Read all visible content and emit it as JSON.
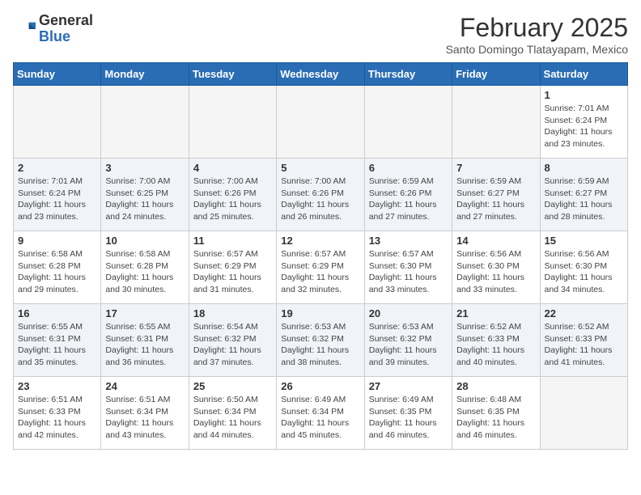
{
  "logo": {
    "line1": "General",
    "line2": "Blue"
  },
  "title": "February 2025",
  "location": "Santo Domingo Tlatayapam, Mexico",
  "days_header": [
    "Sunday",
    "Monday",
    "Tuesday",
    "Wednesday",
    "Thursday",
    "Friday",
    "Saturday"
  ],
  "weeks": [
    [
      {
        "day": "",
        "info": ""
      },
      {
        "day": "",
        "info": ""
      },
      {
        "day": "",
        "info": ""
      },
      {
        "day": "",
        "info": ""
      },
      {
        "day": "",
        "info": ""
      },
      {
        "day": "",
        "info": ""
      },
      {
        "day": "1",
        "info": "Sunrise: 7:01 AM\nSunset: 6:24 PM\nDaylight: 11 hours and 23 minutes."
      }
    ],
    [
      {
        "day": "2",
        "info": "Sunrise: 7:01 AM\nSunset: 6:24 PM\nDaylight: 11 hours and 23 minutes."
      },
      {
        "day": "3",
        "info": "Sunrise: 7:00 AM\nSunset: 6:25 PM\nDaylight: 11 hours and 24 minutes."
      },
      {
        "day": "4",
        "info": "Sunrise: 7:00 AM\nSunset: 6:26 PM\nDaylight: 11 hours and 25 minutes."
      },
      {
        "day": "5",
        "info": "Sunrise: 7:00 AM\nSunset: 6:26 PM\nDaylight: 11 hours and 26 minutes."
      },
      {
        "day": "6",
        "info": "Sunrise: 6:59 AM\nSunset: 6:26 PM\nDaylight: 11 hours and 27 minutes."
      },
      {
        "day": "7",
        "info": "Sunrise: 6:59 AM\nSunset: 6:27 PM\nDaylight: 11 hours and 27 minutes."
      },
      {
        "day": "8",
        "info": "Sunrise: 6:59 AM\nSunset: 6:27 PM\nDaylight: 11 hours and 28 minutes."
      }
    ],
    [
      {
        "day": "9",
        "info": "Sunrise: 6:58 AM\nSunset: 6:28 PM\nDaylight: 11 hours and 29 minutes."
      },
      {
        "day": "10",
        "info": "Sunrise: 6:58 AM\nSunset: 6:28 PM\nDaylight: 11 hours and 30 minutes."
      },
      {
        "day": "11",
        "info": "Sunrise: 6:57 AM\nSunset: 6:29 PM\nDaylight: 11 hours and 31 minutes."
      },
      {
        "day": "12",
        "info": "Sunrise: 6:57 AM\nSunset: 6:29 PM\nDaylight: 11 hours and 32 minutes."
      },
      {
        "day": "13",
        "info": "Sunrise: 6:57 AM\nSunset: 6:30 PM\nDaylight: 11 hours and 33 minutes."
      },
      {
        "day": "14",
        "info": "Sunrise: 6:56 AM\nSunset: 6:30 PM\nDaylight: 11 hours and 33 minutes."
      },
      {
        "day": "15",
        "info": "Sunrise: 6:56 AM\nSunset: 6:30 PM\nDaylight: 11 hours and 34 minutes."
      }
    ],
    [
      {
        "day": "16",
        "info": "Sunrise: 6:55 AM\nSunset: 6:31 PM\nDaylight: 11 hours and 35 minutes."
      },
      {
        "day": "17",
        "info": "Sunrise: 6:55 AM\nSunset: 6:31 PM\nDaylight: 11 hours and 36 minutes."
      },
      {
        "day": "18",
        "info": "Sunrise: 6:54 AM\nSunset: 6:32 PM\nDaylight: 11 hours and 37 minutes."
      },
      {
        "day": "19",
        "info": "Sunrise: 6:53 AM\nSunset: 6:32 PM\nDaylight: 11 hours and 38 minutes."
      },
      {
        "day": "20",
        "info": "Sunrise: 6:53 AM\nSunset: 6:32 PM\nDaylight: 11 hours and 39 minutes."
      },
      {
        "day": "21",
        "info": "Sunrise: 6:52 AM\nSunset: 6:33 PM\nDaylight: 11 hours and 40 minutes."
      },
      {
        "day": "22",
        "info": "Sunrise: 6:52 AM\nSunset: 6:33 PM\nDaylight: 11 hours and 41 minutes."
      }
    ],
    [
      {
        "day": "23",
        "info": "Sunrise: 6:51 AM\nSunset: 6:33 PM\nDaylight: 11 hours and 42 minutes."
      },
      {
        "day": "24",
        "info": "Sunrise: 6:51 AM\nSunset: 6:34 PM\nDaylight: 11 hours and 43 minutes."
      },
      {
        "day": "25",
        "info": "Sunrise: 6:50 AM\nSunset: 6:34 PM\nDaylight: 11 hours and 44 minutes."
      },
      {
        "day": "26",
        "info": "Sunrise: 6:49 AM\nSunset: 6:34 PM\nDaylight: 11 hours and 45 minutes."
      },
      {
        "day": "27",
        "info": "Sunrise: 6:49 AM\nSunset: 6:35 PM\nDaylight: 11 hours and 46 minutes."
      },
      {
        "day": "28",
        "info": "Sunrise: 6:48 AM\nSunset: 6:35 PM\nDaylight: 11 hours and 46 minutes."
      },
      {
        "day": "",
        "info": ""
      }
    ]
  ]
}
